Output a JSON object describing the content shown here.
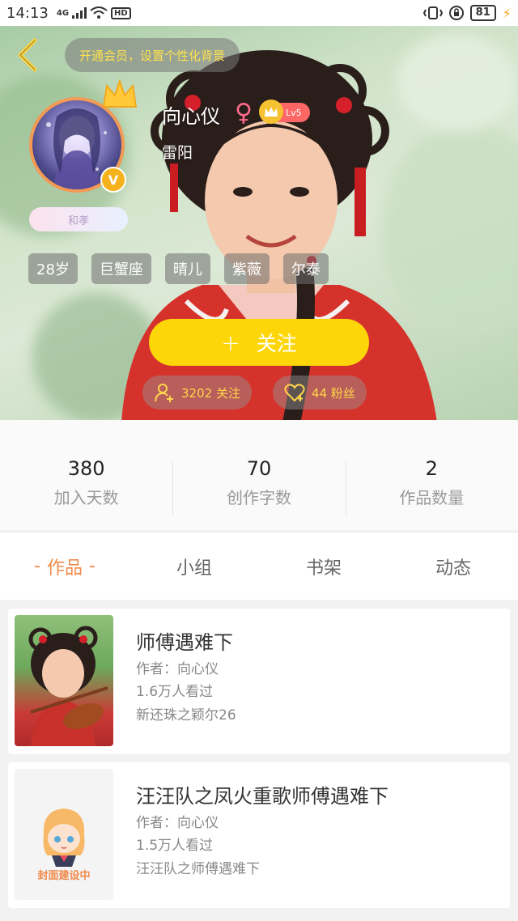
{
  "status_bar": {
    "time": "14:13",
    "network": "4G",
    "hd": "HD",
    "battery": "81"
  },
  "hero": {
    "vip_banner": "开通会员，设置个性化背景",
    "username": "向心仪",
    "gender_symbol": "♀",
    "level": "Lv5",
    "location": "雷阳",
    "avatar_title": "和孝",
    "verified_badge": "V",
    "tags": [
      "28岁",
      "巨蟹座",
      "晴儿",
      "紫薇",
      "尔泰"
    ],
    "follow_button": "关注",
    "follow_plus": "+",
    "following_count": "3202 关注",
    "fans_count": "44 粉丝"
  },
  "stats": [
    {
      "value": "380",
      "label": "加入天数"
    },
    {
      "value": "70",
      "label": "创作字数"
    },
    {
      "value": "2",
      "label": "作品数量"
    }
  ],
  "tabs": {
    "active_dash": "-",
    "items": [
      "作品",
      "小组",
      "书架",
      "动态"
    ]
  },
  "works": [
    {
      "title": "师傅遇难下",
      "author": "作者：向心仪",
      "views": "1.6万人看过",
      "series": "新还珠之颖尔26"
    },
    {
      "title": "汪汪队之凤火重歌师傅遇难下",
      "author": "作者：向心仪",
      "views": "1.5万人看过",
      "series": "汪汪队之师傅遇难下",
      "cover_placeholder": "封面建设中"
    }
  ],
  "colors": {
    "accent": "#f08a4b",
    "follow_yellow": "#fdd60a",
    "vip_text": "#ffe14d"
  }
}
